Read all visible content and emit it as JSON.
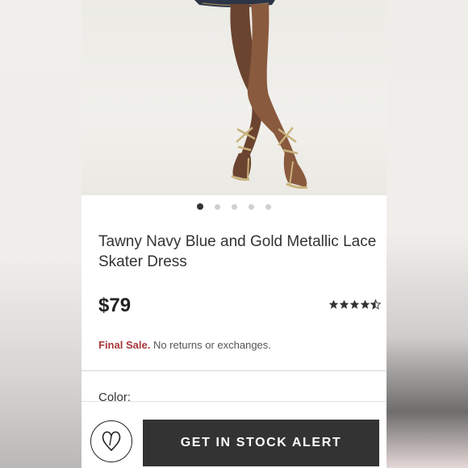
{
  "product": {
    "title": "Tawny Navy Blue and Gold Metallic Lace Skater Dress",
    "price": "$79",
    "rating": 4.5,
    "rating_max": 5,
    "final_sale_label": "Final Sale.",
    "final_sale_text": "No returns or exchanges.",
    "color_label": "Color:"
  },
  "carousel": {
    "total": 5,
    "active_index": 0
  },
  "actions": {
    "stock_alert_label": "GET IN STOCK ALERT",
    "wishlist_icon": "heart-outline-icon"
  },
  "colors": {
    "button_bg": "#333333",
    "final_sale": "#a6363b",
    "text": "#333333"
  }
}
